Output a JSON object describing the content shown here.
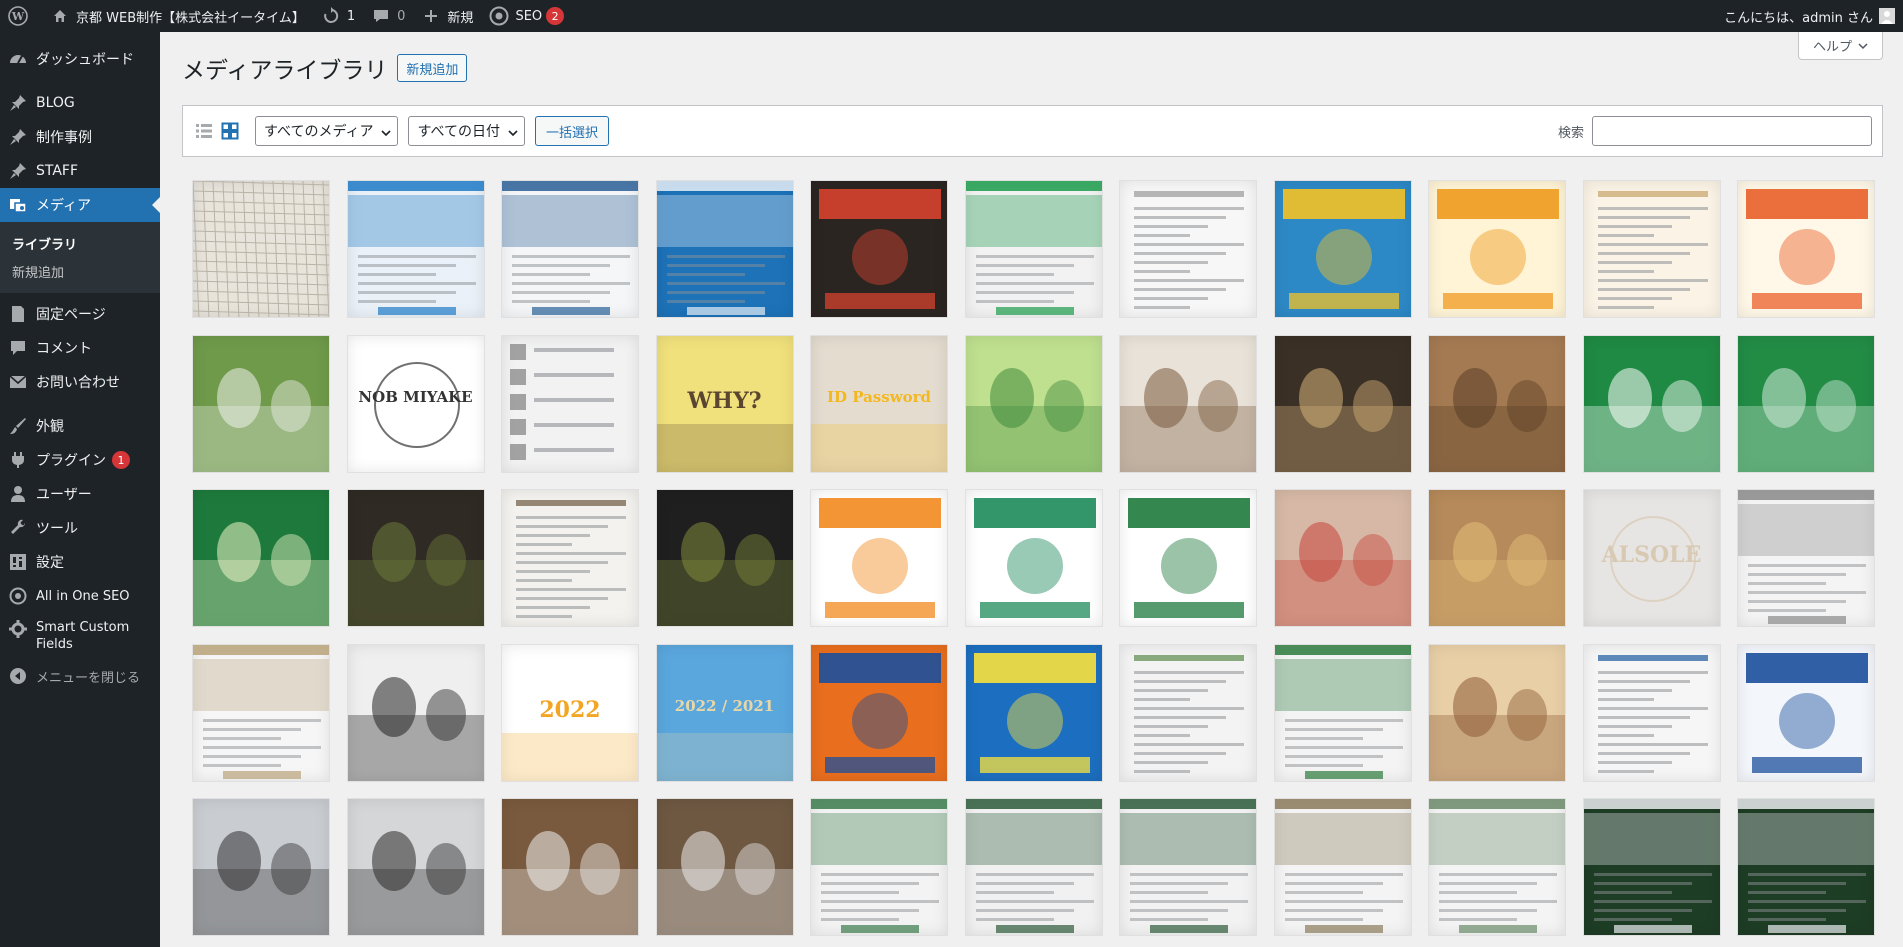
{
  "adminbar": {
    "site_name": "京都 WEB制作【株式会社イータイム】",
    "updates_count": "1",
    "comments_count": "0",
    "new_label": "新規",
    "seo_label": "SEO",
    "seo_count": "2",
    "greeting": "こんにちは、admin さん"
  },
  "sidebar": {
    "items": [
      {
        "label": "ダッシュボード",
        "icon": "dashboard-icon"
      },
      {
        "label": "BLOG",
        "icon": "pin-icon"
      },
      {
        "label": "制作事例",
        "icon": "pin-icon"
      },
      {
        "label": "STAFF",
        "icon": "pin-icon"
      },
      {
        "label": "メディア",
        "icon": "media-icon"
      },
      {
        "label": "固定ページ",
        "icon": "page-icon"
      },
      {
        "label": "コメント",
        "icon": "comment-icon"
      },
      {
        "label": "お問い合わせ",
        "icon": "mail-icon"
      },
      {
        "label": "外観",
        "icon": "brush-icon"
      },
      {
        "label": "プラグイン",
        "icon": "plugin-icon",
        "badge": "1"
      },
      {
        "label": "ユーザー",
        "icon": "user-icon"
      },
      {
        "label": "ツール",
        "icon": "wrench-icon"
      },
      {
        "label": "設定",
        "icon": "settings-icon"
      },
      {
        "label": "All in One SEO",
        "icon": "seo-icon"
      },
      {
        "label": "Smart Custom Fields",
        "icon": "gear-icon"
      }
    ],
    "submenu": [
      "ライブラリ",
      "新規追加"
    ],
    "collapse_label": "メニューを閉じる"
  },
  "help_label": "ヘルプ",
  "page": {
    "title": "メディアライブラリ",
    "add_new": "新規追加"
  },
  "toolbar": {
    "media_filter": "すべてのメディア",
    "date_filter": "すべての日付",
    "bulk_select": "一括選択",
    "search_label": "検索",
    "search_value": ""
  },
  "media_tiles": [
    {
      "bg": "#e8e4dc",
      "fg": "#b9b2a6",
      "style": "map"
    },
    {
      "bg": "#eaf1f8",
      "fg": "#1f7ac7",
      "style": "web"
    },
    {
      "bg": "#f4f6f8",
      "fg": "#2a5f96",
      "style": "web"
    },
    {
      "bg": "#1d72b8",
      "fg": "#e5eef7",
      "style": "web"
    },
    {
      "bg": "#2b2522",
      "fg": "#d6422e",
      "style": "poster"
    },
    {
      "bg": "#f2f2f2",
      "fg": "#1b9b4a",
      "style": "web"
    },
    {
      "bg": "#f7f7f7",
      "fg": "#9a9a9a",
      "style": "doc"
    },
    {
      "bg": "#2d89c6",
      "fg": "#f3c224",
      "style": "poster"
    },
    {
      "bg": "#fff4d6",
      "fg": "#f09a1e",
      "style": "poster"
    },
    {
      "bg": "#fbf4e6",
      "fg": "#c6a36a",
      "style": "doc"
    },
    {
      "bg": "#fff8e8",
      "fg": "#e95f2a",
      "style": "poster"
    },
    {
      "bg": "#6f9a4a",
      "fg": "#eef0ec",
      "style": "photo"
    },
    {
      "bg": "#ffffff",
      "fg": "#333333",
      "style": "logo",
      "text": "NOB MIYAKE"
    },
    {
      "bg": "#f2f2f2",
      "fg": "#6c6c6c",
      "style": "list"
    },
    {
      "bg": "#f1e17c",
      "fg": "#5a4630",
      "style": "text",
      "text": "WHY?"
    },
    {
      "bg": "#e4dccf",
      "fg": "#f3b81f",
      "style": "text",
      "text": "ID Password"
    },
    {
      "bg": "#bfe08f",
      "fg": "#3f8a3c",
      "style": "photo"
    },
    {
      "bg": "#e9e2d8",
      "fg": "#7a5a3e",
      "style": "photo"
    },
    {
      "bg": "#3a3026",
      "fg": "#d6b27a",
      "style": "photo"
    },
    {
      "bg": "#a47a52",
      "fg": "#5a3e26",
      "style": "photo"
    },
    {
      "bg": "#1f8a43",
      "fg": "#ffffff",
      "style": "photo"
    },
    {
      "bg": "#228c45",
      "fg": "#d4eadb",
      "style": "photo"
    },
    {
      "bg": "#1e7a3c",
      "fg": "#f1f4c9",
      "style": "photo"
    },
    {
      "bg": "#2f2a24",
      "fg": "#6c7a3a",
      "style": "photo"
    },
    {
      "bg": "#f4f2ee",
      "fg": "#6d5a42",
      "style": "doc"
    },
    {
      "bg": "#1f1f1f",
      "fg": "#7f8a3a",
      "style": "photo"
    },
    {
      "bg": "#ffffff",
      "fg": "#f28a1e",
      "style": "poster"
    },
    {
      "bg": "#ffffff",
      "fg": "#1d8a5a",
      "style": "poster"
    },
    {
      "bg": "#ffffff",
      "fg": "#1e7a3c",
      "style": "poster"
    },
    {
      "bg": "#d7b8a6",
      "fg": "#c5443a",
      "style": "photo"
    },
    {
      "bg": "#b68a5a",
      "fg": "#e6c07a",
      "style": "photo"
    },
    {
      "bg": "#e7e5e3",
      "fg": "#d8c9b3",
      "style": "logo",
      "text": "ALSOLE"
    },
    {
      "bg": "#f4f4f4",
      "fg": "#8a8a8a",
      "style": "web"
    },
    {
      "bg": "#f6f6f6",
      "fg": "#b9a37a",
      "style": "web"
    },
    {
      "bg": "#efefef",
      "fg": "#222222",
      "style": "photo"
    },
    {
      "bg": "#ffffff",
      "fg": "#f2a623",
      "style": "text",
      "text": "2022"
    },
    {
      "bg": "#5aa7de",
      "fg": "#e8d7a8",
      "style": "text",
      "text": "2022 / 2021"
    },
    {
      "bg": "#e96e1e",
      "fg": "#1c4f9c",
      "style": "poster"
    },
    {
      "bg": "#1c6fc0",
      "fg": "#fbe13c",
      "style": "poster"
    },
    {
      "bg": "#f3f3f3",
      "fg": "#5b8a4a",
      "style": "doc"
    },
    {
      "bg": "#f4f4f4",
      "fg": "#2b7a3c",
      "style": "web"
    },
    {
      "bg": "#e8cfa6",
      "fg": "#8c5a34",
      "style": "photo"
    },
    {
      "bg": "#f6f6f6",
      "fg": "#1c5a9c",
      "style": "doc"
    },
    {
      "bg": "#f3f6fb",
      "fg": "#1c4f9c",
      "style": "poster"
    },
    {
      "bg": "#c9cdd2",
      "fg": "#303030",
      "style": "photo"
    },
    {
      "bg": "#d4d6d8",
      "fg": "#2a2a2a",
      "style": "photo"
    },
    {
      "bg": "#7a5a3e",
      "fg": "#f0f0f0",
      "style": "photo"
    },
    {
      "bg": "#6e5842",
      "fg": "#ececec",
      "style": "photo"
    },
    {
      "bg": "#f3f3f3",
      "fg": "#3a7a4a",
      "style": "web"
    },
    {
      "bg": "#f1f1f1",
      "fg": "#2c5a3a",
      "style": "web"
    },
    {
      "bg": "#f2f2f2",
      "fg": "#2c5a3a",
      "style": "web"
    },
    {
      "bg": "#f4f4f4",
      "fg": "#8a7a5a",
      "style": "web"
    },
    {
      "bg": "#f4f4f4",
      "fg": "#6a8a6a",
      "style": "web"
    },
    {
      "bg": "#1e3d25",
      "fg": "#e9ecef",
      "style": "web"
    },
    {
      "bg": "#1e3d25",
      "fg": "#e9ecef",
      "style": "web"
    }
  ]
}
